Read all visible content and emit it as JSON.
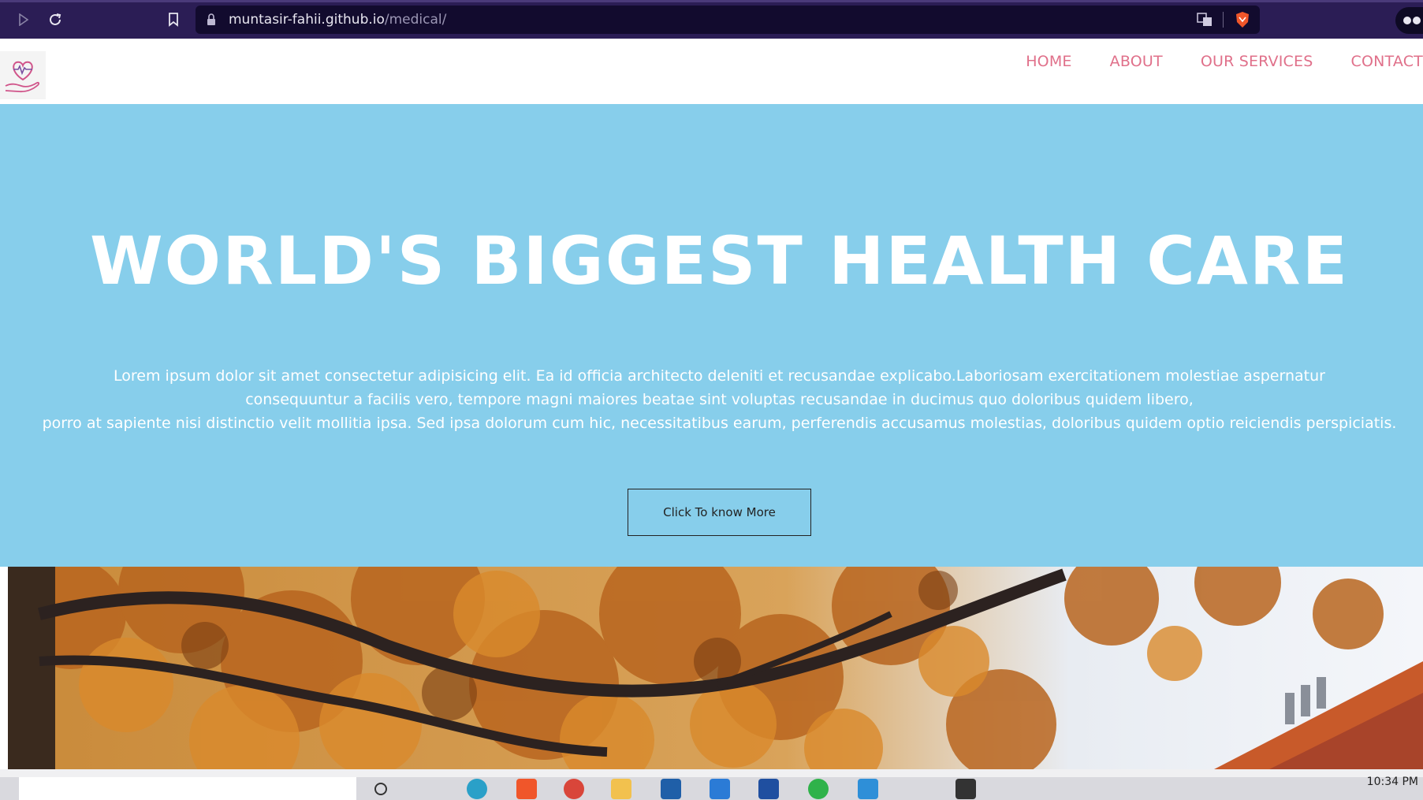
{
  "browser": {
    "url_host": "muntasir-fahii.github.io",
    "url_path": "/medical/"
  },
  "header": {
    "menu": [
      "HOME",
      "ABOUT",
      "OUR SERVICES",
      "CONTACT"
    ]
  },
  "hero": {
    "title": "WORLD'S BIGGEST HEALTH CARE",
    "lines": [
      "Lorem ipsum dolor sit amet consectetur adipisicing elit. Ea id officia architecto deleniti et recusandae explicabo.Laboriosam exercitationem molestiae aspernatur",
      "consequuntur a facilis vero, tempore magni maiores beatae sint voluptas recusandae in ducimus quo doloribus quidem libero,",
      "porro at sapiente nisi distinctio velit mollitia ipsa. Sed ipsa dolorum cum hic, necessitatibus earum, perferendis accusamus molestias, doloribus quidem optio reiciendis perspiciatis."
    ],
    "button": "Click To know More"
  },
  "taskbar": {
    "clock": "10:34 PM"
  },
  "colors": {
    "hero_bg": "#87ceeb",
    "menu_text": "#e0708a",
    "browser_bg": "#2b1d55"
  }
}
